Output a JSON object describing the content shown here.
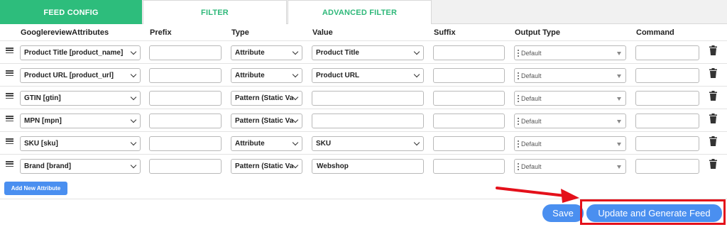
{
  "tabs": [
    "FEED CONFIG",
    "FILTER",
    "ADVANCED FILTER"
  ],
  "headers": {
    "attributes": "GooglereviewAttributes",
    "prefix": "Prefix",
    "type": "Type",
    "value": "Value",
    "suffix": "Suffix",
    "output_type": "Output Type",
    "command": "Command"
  },
  "rows": [
    {
      "attribute": "Product Title [product_name]",
      "prefix": "",
      "type": "Attribute",
      "value": "Product Title",
      "value_kind": "select",
      "suffix": "",
      "output_type": "Default",
      "command": ""
    },
    {
      "attribute": "Product URL [product_url]",
      "prefix": "",
      "type": "Attribute",
      "value": "Product URL",
      "value_kind": "select",
      "suffix": "",
      "output_type": "Default",
      "command": ""
    },
    {
      "attribute": "GTIN [gtin]",
      "prefix": "",
      "type": "Pattern (Static Va",
      "value": "",
      "value_kind": "input",
      "suffix": "",
      "output_type": "Default",
      "command": ""
    },
    {
      "attribute": "MPN [mpn]",
      "prefix": "",
      "type": "Pattern (Static Va",
      "value": "",
      "value_kind": "input",
      "suffix": "",
      "output_type": "Default",
      "command": ""
    },
    {
      "attribute": "SKU [sku]",
      "prefix": "",
      "type": "Attribute",
      "value": "SKU",
      "value_kind": "select",
      "suffix": "",
      "output_type": "Default",
      "command": ""
    },
    {
      "attribute": "Brand [brand]",
      "prefix": "",
      "type": "Pattern (Static Va",
      "value": "Webshop",
      "value_kind": "input",
      "suffix": "",
      "output_type": "Default",
      "command": ""
    }
  ],
  "buttons": {
    "add_attribute": "Add New Attribute",
    "save": "Save",
    "update_generate": "Update and Generate Feed"
  },
  "icons": {
    "drag": "drag-handle-icon",
    "trash": "trash-icon",
    "caret": "chevron-down-icon"
  },
  "colors": {
    "tab_active": "#2dbd7c",
    "tab_text": "#2fb87a",
    "button": "#4a8ff0",
    "highlight": "#e4101a"
  }
}
